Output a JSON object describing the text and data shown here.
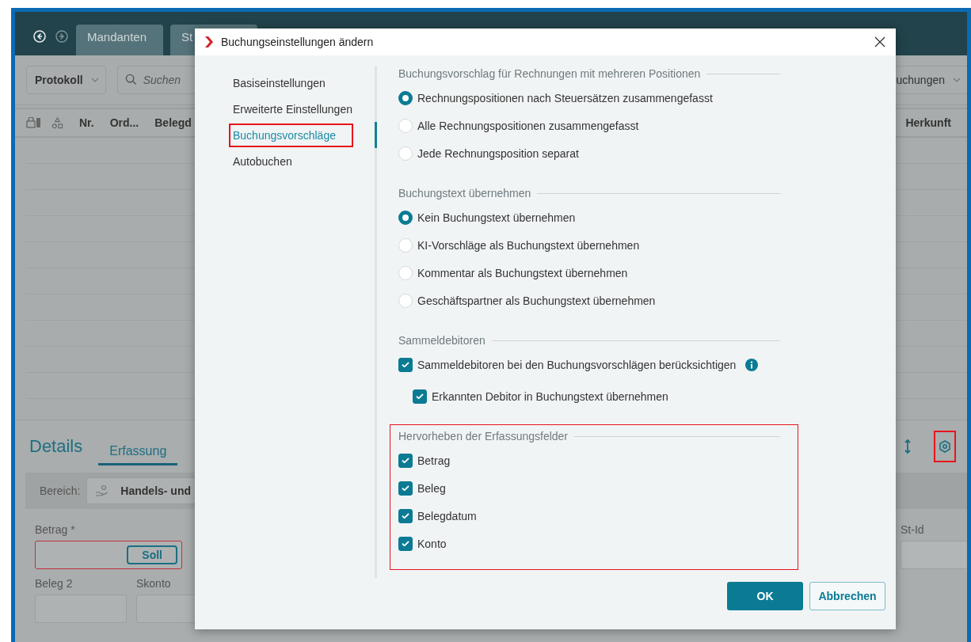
{
  "app": {
    "tabs": [
      {
        "label": "Mandanten",
        "selected": false
      },
      {
        "label": "St",
        "selected": false
      }
    ],
    "toolbar": {
      "view_dropdown": "Protokoll",
      "search_placeholder": "Suchen",
      "right_dropdown": "uchungen"
    },
    "table": {
      "columns_left": [
        "Nr.",
        "Ord...",
        "Belegd"
      ],
      "columns_right": [
        "Herkunft"
      ]
    },
    "details": {
      "title": "Details",
      "tabs": [
        {
          "label": "Erfassung",
          "selected": true
        }
      ],
      "settings_highlighted": true,
      "area_label": "Bereich:",
      "area_value": "Handels- und",
      "fields_left": [
        {
          "label": "Betrag *",
          "button": "Soll",
          "invalid": true
        },
        {
          "label": "Beleg 2",
          "invalid": false
        },
        {
          "label": "Skonto",
          "invalid": false
        }
      ],
      "fields_right": [
        {
          "label": "St-Id",
          "invalid": false
        }
      ]
    }
  },
  "dialog": {
    "title": "Buchungseinstellungen ändern",
    "nav": [
      {
        "label": "Basiseinstellungen",
        "selected": false,
        "highlighted": false
      },
      {
        "label": "Erweiterte Einstellungen",
        "selected": false,
        "highlighted": false
      },
      {
        "label": "Buchungsvorschläge",
        "selected": true,
        "highlighted": true
      },
      {
        "label": "Autobuchen",
        "selected": false,
        "highlighted": false
      }
    ],
    "sections": [
      {
        "title": "Buchungsvorschlag für Rechnungen mit mehreren Positionen",
        "highlighted": false,
        "options": [
          {
            "kind": "radio",
            "label": "Rechnungspositionen nach Steuersätzen zusammengefasst",
            "selected": true
          },
          {
            "kind": "radio",
            "label": "Alle Rechnungspositionen zusammengefasst",
            "selected": false
          },
          {
            "kind": "radio",
            "label": "Jede Rechnungsposition separat",
            "selected": false
          }
        ]
      },
      {
        "title": "Buchungstext übernehmen",
        "highlighted": false,
        "options": [
          {
            "kind": "radio",
            "label": "Kein Buchungstext übernehmen",
            "selected": true
          },
          {
            "kind": "radio",
            "label": "KI-Vorschläge als Buchungstext übernehmen",
            "selected": false
          },
          {
            "kind": "radio",
            "label": "Kommentar als Buchungstext übernehmen",
            "selected": false
          },
          {
            "kind": "radio",
            "label": "Geschäftspartner als Buchungstext übernehmen",
            "selected": false
          }
        ]
      },
      {
        "title": "Sammeldebitoren",
        "highlighted": false,
        "options": [
          {
            "kind": "checkbox",
            "label": "Sammeldebitoren bei den Buchungsvorschlägen berücksichtigen",
            "checked": true,
            "info": true,
            "children": [
              {
                "kind": "checkbox",
                "label": "Erkannten Debitor in Buchungstext übernehmen",
                "checked": true,
                "info": false
              }
            ]
          }
        ]
      },
      {
        "title": "Hervorheben der Erfassungsfelder",
        "highlighted": true,
        "options": [
          {
            "kind": "checkbox",
            "label": "Betrag",
            "checked": true,
            "info": false
          },
          {
            "kind": "checkbox",
            "label": "Beleg",
            "checked": true,
            "info": false
          },
          {
            "kind": "checkbox",
            "label": "Belegdatum",
            "checked": true,
            "info": false
          },
          {
            "kind": "checkbox",
            "label": "Konto",
            "checked": true,
            "info": false
          }
        ]
      }
    ],
    "buttons": [
      {
        "label": "OK",
        "kind": "primary"
      },
      {
        "label": "Abbrechen",
        "kind": "secondary"
      }
    ]
  }
}
